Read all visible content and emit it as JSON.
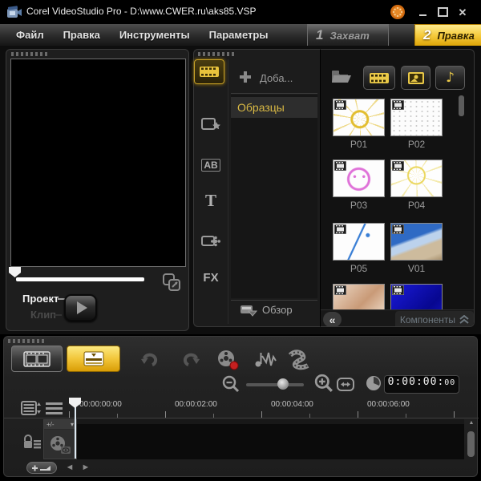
{
  "titlebar": {
    "title": "Corel VideoStudio Pro - D:\\www.CWER.ru\\aks85.VSP"
  },
  "menubar": {
    "items": [
      "Файл",
      "Правка",
      "Инструменты",
      "Параметры"
    ]
  },
  "step_tabs": [
    {
      "number": "1",
      "label": "Захват",
      "active": false
    },
    {
      "number": "2",
      "label": "Правка",
      "active": true
    }
  ],
  "preview": {
    "project_label": "Проект",
    "clip_label": "Клип"
  },
  "library": {
    "add_button_label": "Доба...",
    "selected_category": "Образцы",
    "browse_label": "Обзор",
    "rail_glyphs": {
      "title": "AB",
      "text": "T",
      "filter": "FX"
    }
  },
  "gallery": {
    "collapse_glyph": "«",
    "components_label": "Компоненты",
    "audio_note_glyph": "♪",
    "items": [
      {
        "name": "P01",
        "art": "sun-doodle"
      },
      {
        "name": "P02",
        "art": "map-dots"
      },
      {
        "name": "P03",
        "art": "face-doodle"
      },
      {
        "name": "P04",
        "art": "sun-faint"
      },
      {
        "name": "P05",
        "art": "rocket-doodle"
      },
      {
        "name": "V01",
        "art": "airplane-photo"
      },
      {
        "name": "",
        "art": "tan-texture"
      },
      {
        "name": "",
        "art": "blue-clip"
      }
    ]
  },
  "timeline": {
    "time_display": {
      "main": "0:00:00:",
      "frames": "00"
    },
    "ruler_labels": [
      "00:00:00:00",
      "00:00:02:00",
      "00:00:04:00",
      "00:00:06:00"
    ],
    "track_tools_label": "+/-",
    "track_tools_caret": "▾",
    "nav": {
      "prev_glyph": "◄",
      "next_glyph": "►",
      "scroll_up_glyph": "▲"
    }
  },
  "colors": {
    "accent_gold": "#f2c63a",
    "selected_text_gold": "#d9b944",
    "record_red": "#c42020"
  }
}
